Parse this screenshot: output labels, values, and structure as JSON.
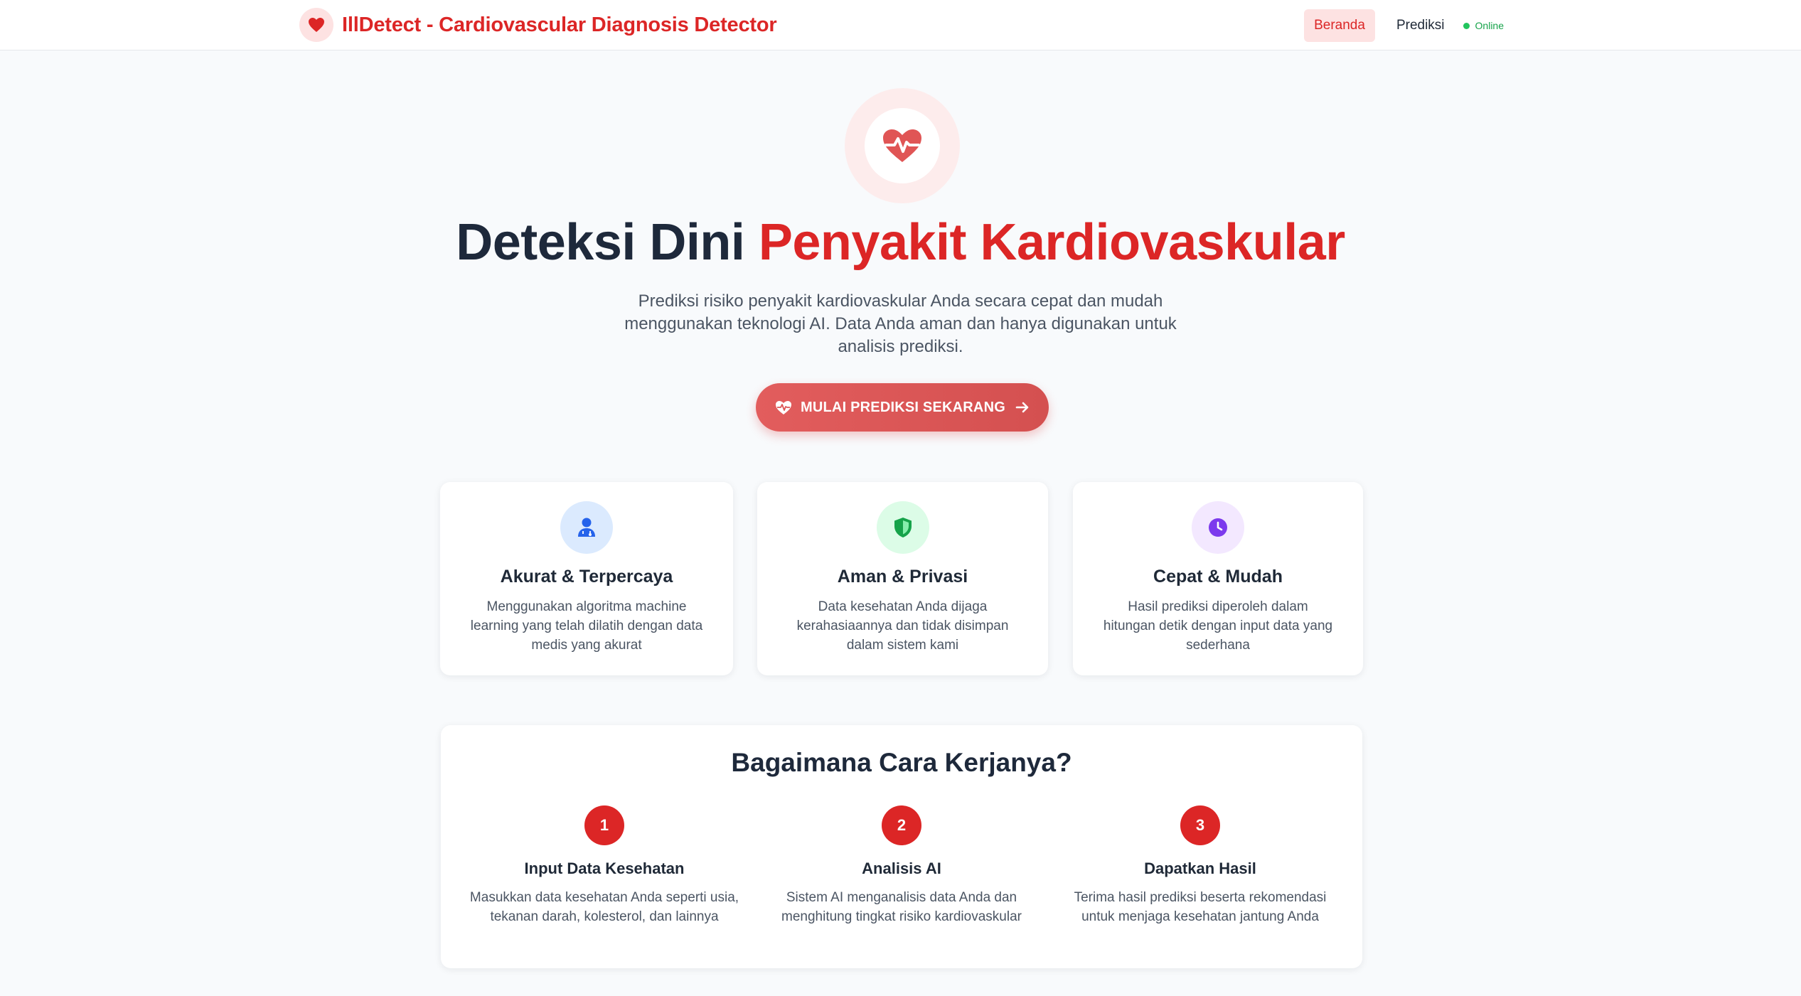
{
  "brand": {
    "title": "IllDetect - Cardiovascular Diagnosis Detector",
    "icon": "heart-icon"
  },
  "nav": {
    "items": [
      {
        "label": "Beranda",
        "active": true
      },
      {
        "label": "Prediksi",
        "active": false
      }
    ],
    "status": "Online"
  },
  "hero": {
    "icon": "heart-pulse-icon",
    "title_part1": "Deteksi Dini ",
    "title_part2": "Penyakit Kardiovaskular",
    "subtitle": "Prediksi risiko penyakit kardiovaskular Anda secara cepat dan mudah menggunakan teknologi AI. Data Anda aman dan hanya digunakan untuk analisis prediksi.",
    "cta_label": "MULAI PREDIKSI SEKARANG"
  },
  "features": [
    {
      "icon": "user-doctor-icon",
      "title": "Akurat & Terpercaya",
      "desc": "Menggunakan algoritma machine learning yang telah dilatih dengan data medis yang akurat"
    },
    {
      "icon": "shield-icon",
      "title": "Aman & Privasi",
      "desc": "Data kesehatan Anda dijaga kerahasiaannya dan tidak disimpan dalam sistem kami"
    },
    {
      "icon": "clock-icon",
      "title": "Cepat & Mudah",
      "desc": "Hasil prediksi diperoleh dalam hitungan detik dengan input data yang sederhana"
    }
  ],
  "how": {
    "title": "Bagaimana Cara Kerjanya?",
    "steps": [
      {
        "num": "1",
        "title": "Input Data Kesehatan",
        "desc": "Masukkan data kesehatan Anda seperti usia, tekanan darah, kolesterol, dan lainnya"
      },
      {
        "num": "2",
        "title": "Analisis AI",
        "desc": "Sistem AI menganalisis data Anda dan menghitung tingkat risiko kardiovaskular"
      },
      {
        "num": "3",
        "title": "Dapatkan Hasil",
        "desc": "Terima hasil prediksi beserta rekomendasi untuk menjaga kesehatan jantung Anda"
      }
    ]
  },
  "colors": {
    "accent": "#dc2626",
    "status": "#22c55e"
  }
}
